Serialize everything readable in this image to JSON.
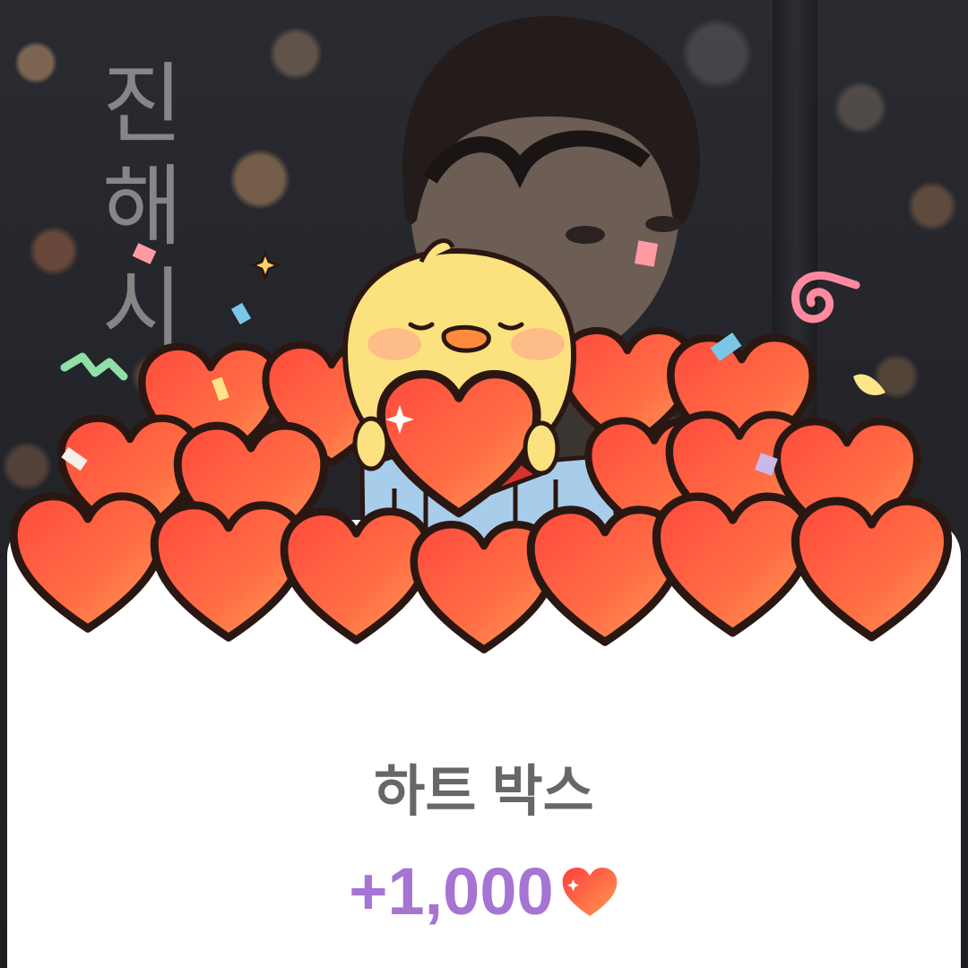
{
  "background": {
    "calligraphy_text": "진\n해\n시"
  },
  "reward_card": {
    "title": "하트 박스",
    "amount": "+1,000",
    "currency_icon": "heart-icon",
    "accent_color": "#a674d3",
    "heart_color": "#ff5a3c",
    "card_color": "#ffffff"
  }
}
